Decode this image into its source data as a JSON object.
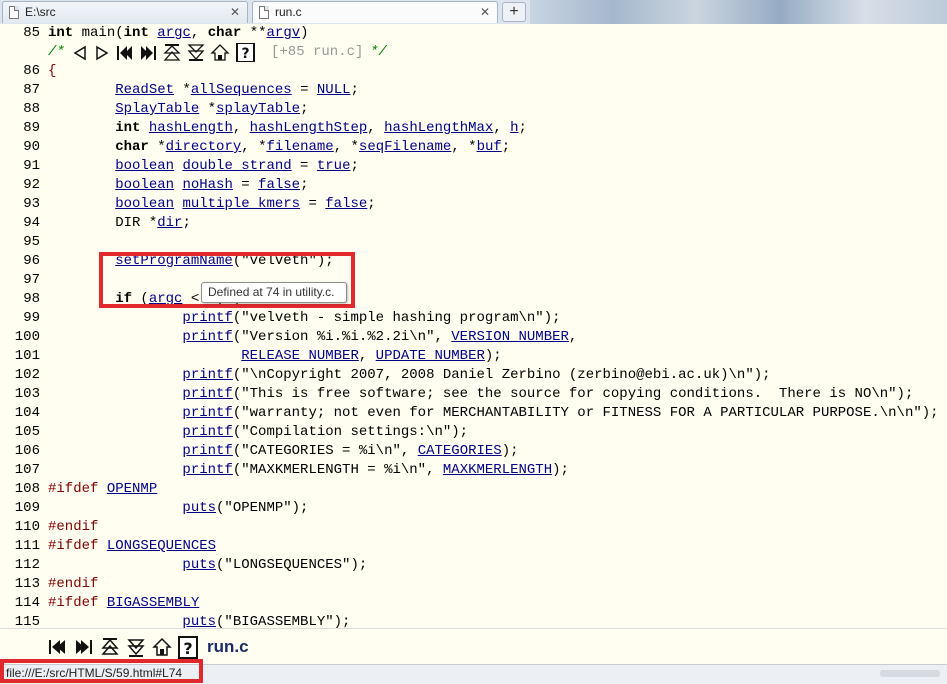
{
  "tabs": [
    {
      "label": "E:\\src",
      "close": "✕"
    },
    {
      "label": "run.c",
      "close": "✕"
    }
  ],
  "new_tab_label": "+",
  "code_lines": [
    {
      "n": "85",
      "html": "<span class='kw'>int</span> main(<span class='kw'>int</span> <span class='lk'>argc</span>, <span class='kw'>char</span> **<span class='lk'>argv</span>)"
    },
    {
      "n": "",
      "nav": true
    },
    {
      "n": "86",
      "html": "<span class='pp'>{</span>"
    },
    {
      "n": "87",
      "html": "        <span class='lk'>ReadSet</span> *<span class='lk'>allSequences</span> = <span class='lk'>NULL</span>;"
    },
    {
      "n": "88",
      "html": "        <span class='lk'>SplayTable</span> *<span class='lk'>splayTable</span>;"
    },
    {
      "n": "89",
      "html": "        <span class='kw'>int</span> <span class='lk'>hashLength</span>, <span class='lk'>hashLengthStep</span>, <span class='lk'>hashLengthMax</span>, <span class='lk'>h</span>;"
    },
    {
      "n": "90",
      "html": "        <span class='kw'>char</span> *<span class='lk'>directory</span>, *<span class='lk'>filename</span>, *<span class='lk'>seqFilename</span>, *<span class='lk'>buf</span>;"
    },
    {
      "n": "91",
      "html": "        <span class='lk'>boolean</span> <span class='lk'>double_strand</span> = <span class='lk'>true</span>;"
    },
    {
      "n": "92",
      "html": "        <span class='lk'>boolean</span> <span class='lk'>noHash</span> = <span class='lk'>false</span>;"
    },
    {
      "n": "93",
      "html": "        <span class='lk'>boolean</span> <span class='lk'>multiple_kmers</span> = <span class='lk'>false</span>;"
    },
    {
      "n": "94",
      "html": "        DIR *<span class='lk'>dir</span>;"
    },
    {
      "n": "95",
      "html": ""
    },
    {
      "n": "96",
      "html": "        <span class='lk'>setProgramName</span>(\"velveth\");"
    },
    {
      "n": "97",
      "html": ""
    },
    {
      "n": "98",
      "html": "        <span class='kw'>if</span> (<span class='lk'>argc</span> < 4) {"
    },
    {
      "n": "99",
      "html": "                <span class='lk'>printf</span>(\"velveth - simple hashing program\\n\");"
    },
    {
      "n": "100",
      "html": "                <span class='lk'>printf</span>(\"Version %i.%i.%2.2i\\n\", <span class='lk'>VERSION_NUMBER</span>,"
    },
    {
      "n": "101",
      "html": "                       <span class='lk'>RELEASE_NUMBER</span>, <span class='lk'>UPDATE_NUMBER</span>);"
    },
    {
      "n": "102",
      "html": "                <span class='lk'>printf</span>(\"\\nCopyright 2007, 2008 Daniel Zerbino (zerbino@ebi.ac.uk)\\n\");"
    },
    {
      "n": "103",
      "html": "                <span class='lk'>printf</span>(\"This is free software; see the source for copying conditions.  There is NO\\n\");"
    },
    {
      "n": "104",
      "html": "                <span class='lk'>printf</span>(\"warranty; not even for MERCHANTABILITY or FITNESS FOR A PARTICULAR PURPOSE.\\n\\n\");"
    },
    {
      "n": "105",
      "html": "                <span class='lk'>printf</span>(\"Compilation settings:\\n\");"
    },
    {
      "n": "106",
      "html": "                <span class='lk'>printf</span>(\"CATEGORIES = %i\\n\", <span class='lk'>CATEGORIES</span>);"
    },
    {
      "n": "107",
      "html": "                <span class='lk'>printf</span>(\"MAXKMERLENGTH = %i\\n\", <span class='lk'>MAXKMERLENGTH</span>);"
    },
    {
      "n": "108",
      "html": "<span class='pp'>#ifdef</span> <span class='lk'>OPENMP</span>"
    },
    {
      "n": "109",
      "html": "                <span class='lk'>puts</span>(\"OPENMP\");"
    },
    {
      "n": "110",
      "html": "<span class='pp'>#endif</span>"
    },
    {
      "n": "111",
      "html": "<span class='pp'>#ifdef</span> <span class='lk'>LONGSEQUENCES</span>"
    },
    {
      "n": "112",
      "html": "                <span class='lk'>puts</span>(\"LONGSEQUENCES\");"
    },
    {
      "n": "113",
      "html": "<span class='pp'>#endif</span>"
    },
    {
      "n": "114",
      "html": "<span class='pp'>#ifdef</span> <span class='lk'>BIGASSEMBLY</span>"
    },
    {
      "n": "115",
      "html": "                <span class='lk'>puts</span>(\"BIGASSEMBLY\");"
    }
  ],
  "nav_comment_open": "/*",
  "nav_comment_ref": "[+85 run.c]",
  "nav_comment_close": "*/",
  "tooltip": "Defined at 74 in utility.c.",
  "bottom_title": "run.c",
  "status_url": "file:///E:/src/HTML/S/59.html#L74",
  "colors": {
    "highlight_box": "#e0282e",
    "background": "#fffef0",
    "link": "#000088"
  }
}
